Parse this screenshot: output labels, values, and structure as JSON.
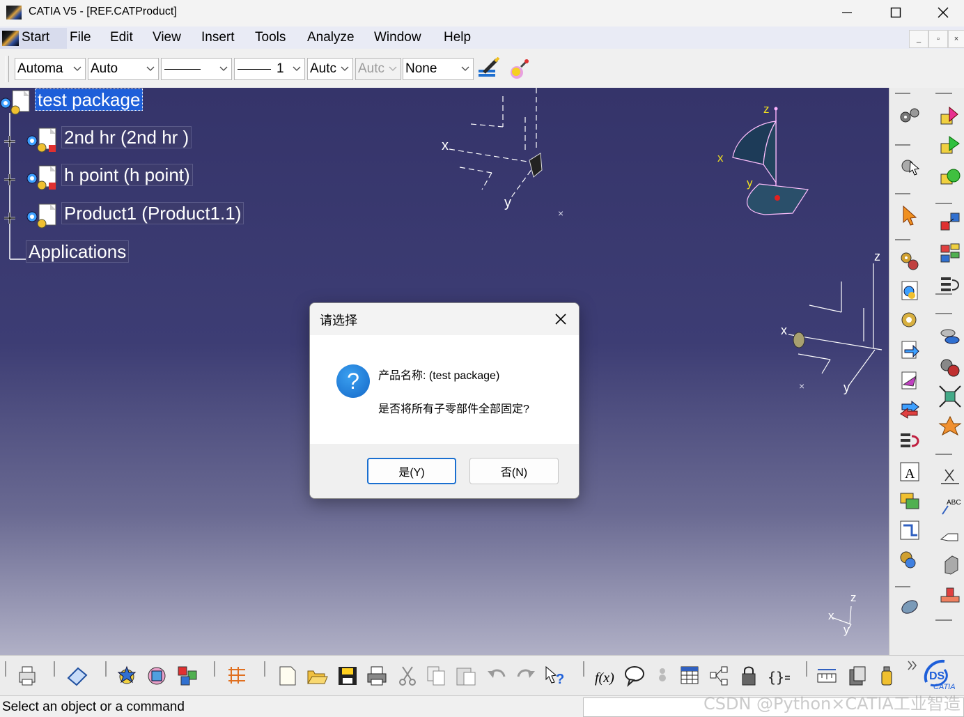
{
  "window": {
    "title": "CATIA V5 - [REF.CATProduct]",
    "minimize": "—",
    "maximize": "☐",
    "close": "✕"
  },
  "menubar": {
    "start": "Start",
    "items": [
      "File",
      "Edit",
      "View",
      "Insert",
      "Tools",
      "Analyze",
      "Window",
      "Help"
    ]
  },
  "toolbar": {
    "combo_color": "Automa",
    "combo_linetype": "Auto",
    "combo_thickness_value": "1",
    "combo_point": "Autc",
    "combo_disabled": "Autc",
    "combo_layer": "None"
  },
  "tree": {
    "root": "test package",
    "children": [
      "2nd hr  (2nd hr )",
      "h point (h point)",
      "Product1 (Product1.1)"
    ],
    "applications": "Applications"
  },
  "axes": {
    "x": "x",
    "y": "y",
    "z": "z"
  },
  "dialog": {
    "title": "请选择",
    "line1": "产品名称: (test package)",
    "line2": "是否将所有子零部件全部固定?",
    "yes_button": "是(Y)",
    "no_button": "否(N)"
  },
  "status": {
    "text": "Select an object or a command"
  },
  "watermark": "CSDN @Python×CATIA工业智造",
  "colors": {
    "viewport_top": "#35346a",
    "viewport_bottom": "#b0b0c6",
    "selection": "#1e5fd9",
    "dialog_accent": "#1a6fd0"
  }
}
